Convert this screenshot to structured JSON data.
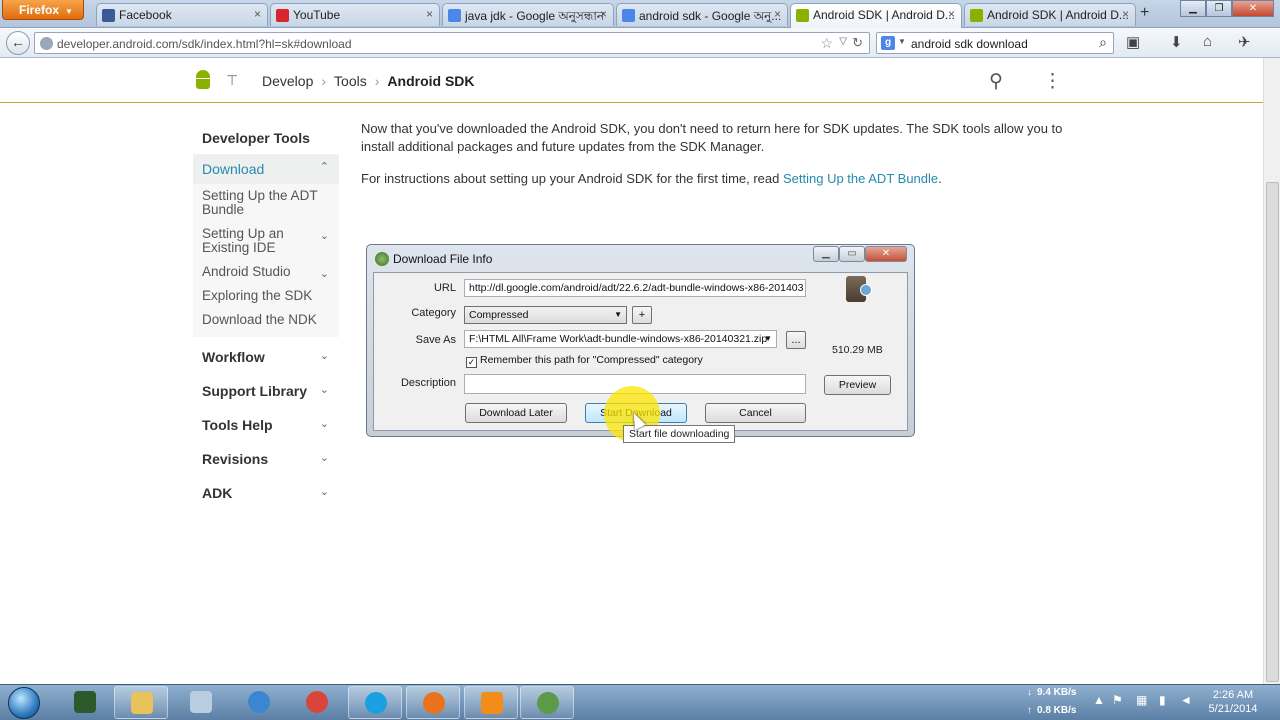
{
  "browser": {
    "menu_button": "Firefox",
    "tabs": [
      {
        "title": "Facebook",
        "color": "#3b5998"
      },
      {
        "title": "YouTube",
        "color": "#d8262c"
      },
      {
        "title": "java jdk - Google অনুসন্ধান",
        "color": "#4b86e8"
      },
      {
        "title": "android sdk - Google অনু...",
        "color": "#4b86e8"
      },
      {
        "title": "Android SDK | Android D...",
        "color": "#8ab000",
        "active": true
      },
      {
        "title": "Android SDK | Android D...",
        "color": "#8ab000"
      }
    ],
    "url": "developer.android.com/sdk/index.html?hl=sk#download",
    "search_query": "android sdk download"
  },
  "site": {
    "breadcrumb": [
      "Develop",
      "Tools",
      "Android SDK"
    ]
  },
  "sidebar": {
    "developer_tools": "Developer Tools",
    "download": {
      "label": "Download",
      "children": [
        "Setting Up the ADT Bundle",
        "Setting Up an Existing IDE",
        "Android Studio",
        "Exploring the SDK",
        "Download the NDK"
      ]
    },
    "sections": [
      "Workflow",
      "Support Library",
      "Tools Help",
      "Revisions",
      "ADK"
    ]
  },
  "content": {
    "para1": "Now that you've downloaded the Android SDK, you don't need to return here for SDK updates. The SDK tools allow you to install additional packages and future updates from the SDK Manager.",
    "para2_prefix": "For instructions about setting up your Android SDK for the first time, read ",
    "para2_link": "Setting Up the ADT Bundle",
    "para2_suffix": "."
  },
  "dialog": {
    "title": "Download File Info",
    "url_label": "URL",
    "url_value": "http://dl.google.com/android/adt/22.6.2/adt-bundle-windows-x86-201403",
    "category_label": "Category",
    "category_value": "Compressed",
    "add_button": "+",
    "save_as_label": "Save As",
    "save_as_value": "F:\\HTML All\\Frame Work\\adt-bundle-windows-x86-20140321.zip",
    "browse_button": "...",
    "remember_label": "Remember this path for \"Compressed\" category",
    "remember_checked": true,
    "description_label": "Description",
    "description_value": "",
    "file_size": "510.29 MB",
    "preview_button": "Preview",
    "download_later_button": "Download Later",
    "start_download_button": "Start Download",
    "cancel_button": "Cancel",
    "tooltip": "Start file downloading"
  },
  "taskbar": {
    "download_speed": "9.4 KB/s",
    "upload_speed": "0.8 KB/s",
    "time": "2:26 AM",
    "date": "5/21/2014"
  }
}
